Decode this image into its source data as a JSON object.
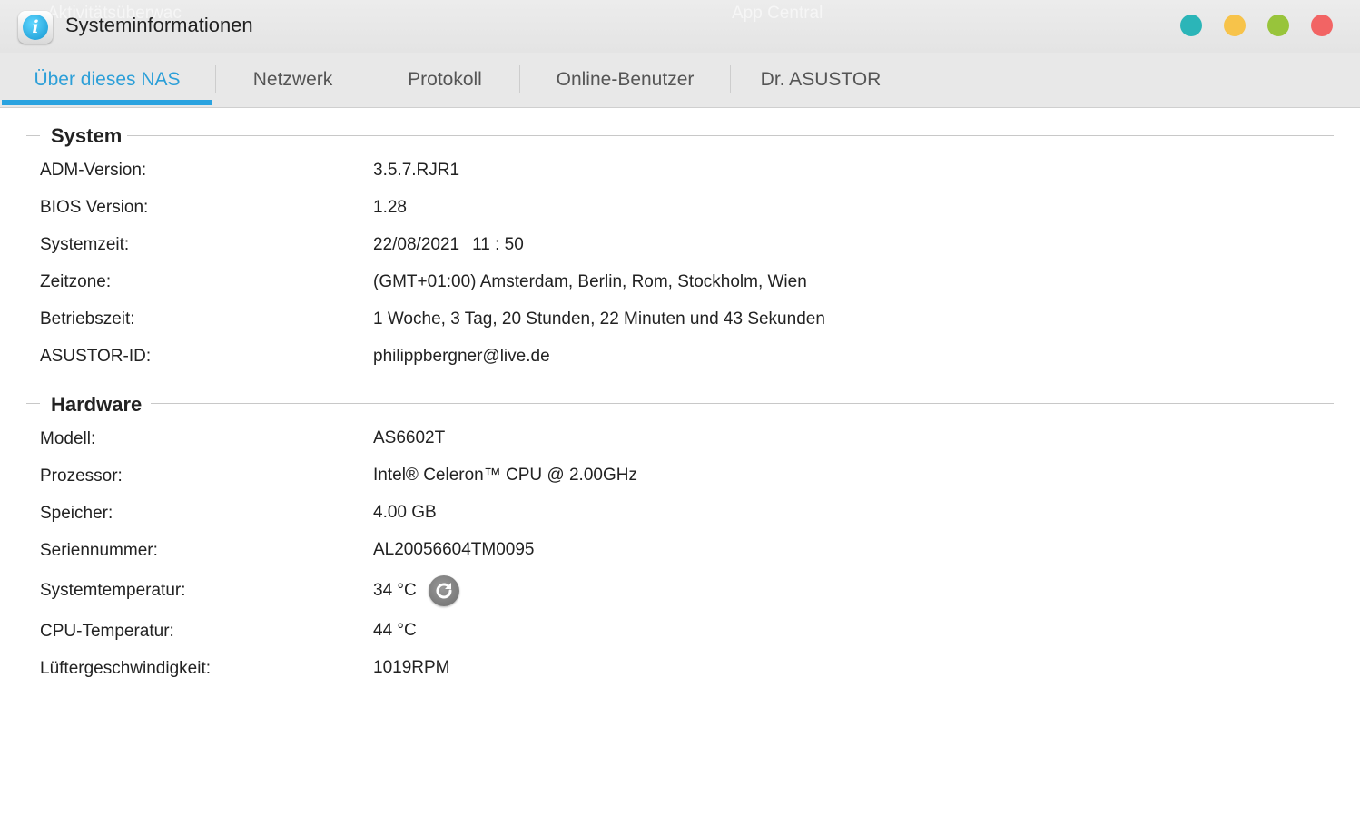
{
  "window": {
    "title": "Systeminformationen",
    "background_ghost_titles": [
      "Aktivitätsüberwac",
      "App Central"
    ],
    "controls": [
      "teal",
      "yellow",
      "green",
      "red"
    ],
    "colors": {
      "accent": "#2aa3e0",
      "btn_teal": "#2bb5b8",
      "btn_yellow": "#f7c34a",
      "btn_green": "#98c43b",
      "btn_red": "#f26464"
    }
  },
  "tabs": [
    {
      "label": "Über dieses NAS",
      "active": true
    },
    {
      "label": "Netzwerk",
      "active": false
    },
    {
      "label": "Protokoll",
      "active": false
    },
    {
      "label": "Online-Benutzer",
      "active": false
    },
    {
      "label": "Dr. ASUSTOR",
      "active": false
    }
  ],
  "system": {
    "title": "System",
    "rows": [
      {
        "label": "ADM-Version:",
        "value": "3.5.7.RJR1"
      },
      {
        "label": "BIOS Version:",
        "value": "1.28"
      },
      {
        "label": "Systemzeit:",
        "date": "22/08/2021",
        "time": "11 : 50"
      },
      {
        "label": "Zeitzone:",
        "value": "(GMT+01:00) Amsterdam, Berlin, Rom, Stockholm, Wien"
      },
      {
        "label": "Betriebszeit:",
        "value": "1 Woche, 3 Tag, 20 Stunden, 22 Minuten und 43 Sekunden"
      },
      {
        "label": "ASUSTOR-ID:",
        "value": "philippbergner@live.de"
      }
    ]
  },
  "hardware": {
    "title": "Hardware",
    "rows": [
      {
        "label": "Modell:",
        "value": "AS6602T"
      },
      {
        "label": "Prozessor:",
        "value": "Intel® Celeron™ CPU @ 2.00GHz"
      },
      {
        "label": "Speicher:",
        "value": "4.00 GB"
      },
      {
        "label": "Seriennummer:",
        "value": "AL20056604TM0095"
      },
      {
        "label": "Systemtemperatur:",
        "value": "34 °C",
        "action_icon": "refresh-icon"
      },
      {
        "label": "CPU-Temperatur:",
        "value": "44 °C"
      },
      {
        "label": "Lüftergeschwindigkeit:",
        "value": "1019RPM"
      }
    ]
  }
}
